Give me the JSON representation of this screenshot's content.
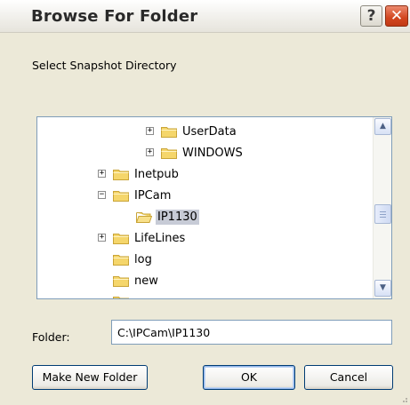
{
  "window": {
    "title": "Browse For Folder",
    "help_glyph": "?",
    "close_glyph": "✕"
  },
  "prompt": "Select Snapshot Directory",
  "tree": {
    "nodes": [
      {
        "label": "UserData",
        "expander": "+",
        "selected": false
      },
      {
        "label": "WINDOWS",
        "expander": "+",
        "selected": false
      },
      {
        "label": "Inetpub",
        "expander": "+",
        "selected": false
      },
      {
        "label": "IPCam",
        "expander": "−",
        "selected": false
      },
      {
        "label": "IP1130",
        "expander": "",
        "selected": true
      },
      {
        "label": "LifeLines",
        "expander": "+",
        "selected": false
      },
      {
        "label": "log",
        "expander": "",
        "selected": false
      },
      {
        "label": "new",
        "expander": "",
        "selected": false
      }
    ],
    "scroll_up_glyph": "▲",
    "scroll_down_glyph": "▼"
  },
  "folder": {
    "label": "Folder:",
    "value": "C:\\IPCam\\IP1130"
  },
  "buttons": {
    "make_new_folder": "Make New Folder",
    "ok": "OK",
    "cancel": "Cancel"
  },
  "colors": {
    "selection": "#c7cbd6",
    "folder_yellow": "#f5d66b",
    "tree_border": "#7f9db9"
  }
}
